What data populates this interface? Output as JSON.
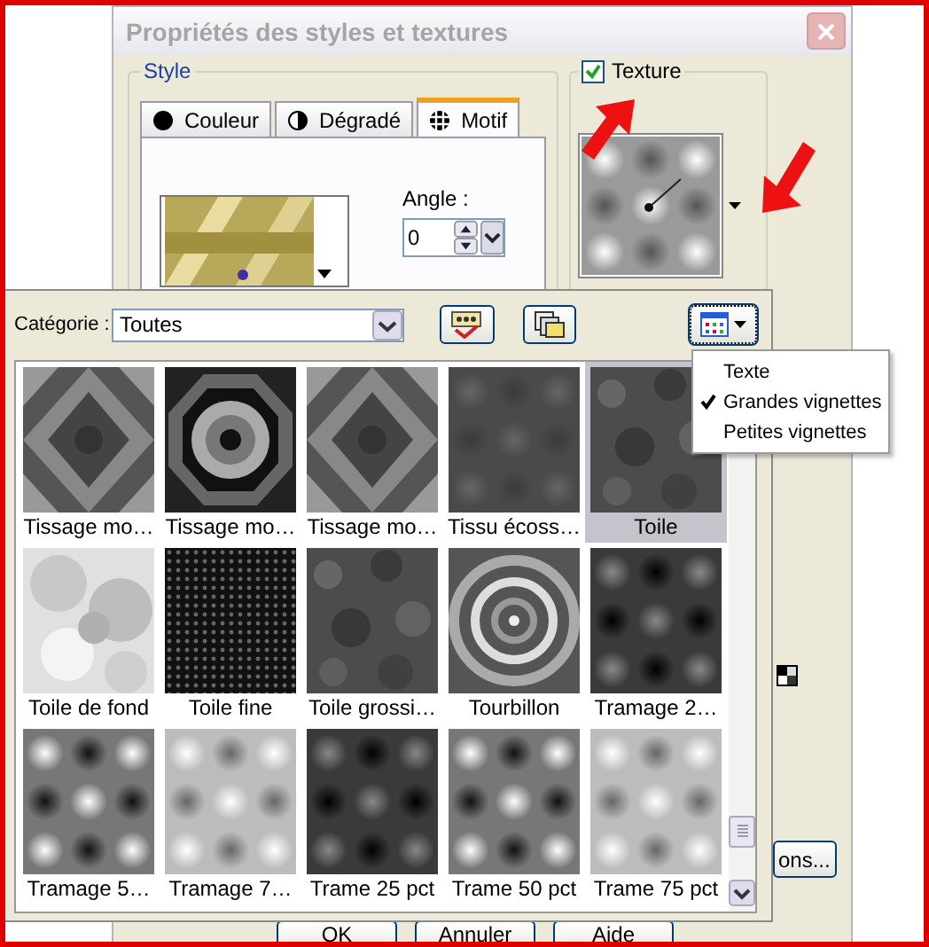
{
  "window": {
    "title": "Propriétés des styles et textures"
  },
  "style_group": {
    "title": "Style",
    "tabs": [
      {
        "label": "Couleur",
        "selected": false
      },
      {
        "label": "Dégradé",
        "selected": false
      },
      {
        "label": "Motif",
        "selected": true
      }
    ],
    "angle": {
      "label": "Angle :",
      "value": "0"
    }
  },
  "texture": {
    "label": "Texture",
    "checked": true
  },
  "options_button": "ons...",
  "buttons": [
    "OK",
    "Annuler",
    "Aide"
  ],
  "pattern_picker": {
    "category_label": "Catégorie :",
    "category_value": "Toutes",
    "thumbnails": [
      {
        "label": "Tissage mo…",
        "selected": false
      },
      {
        "label": "Tissage mo…",
        "selected": false
      },
      {
        "label": "Tissage mo…",
        "selected": false
      },
      {
        "label": "Tissu écoss…",
        "selected": false
      },
      {
        "label": "Toile",
        "selected": true
      },
      {
        "label": "Toile de fond",
        "selected": false
      },
      {
        "label": "Toile fine",
        "selected": false
      },
      {
        "label": "Toile grossi…",
        "selected": false
      },
      {
        "label": "Tourbillon",
        "selected": false
      },
      {
        "label": "Tramage 2…",
        "selected": false
      },
      {
        "label": "Tramage 5…",
        "selected": false
      },
      {
        "label": "Tramage 7…",
        "selected": false
      },
      {
        "label": "Trame 25 pct",
        "selected": false
      },
      {
        "label": "Trame 50 pct",
        "selected": false
      },
      {
        "label": "Trame 75 pct",
        "selected": false
      }
    ]
  },
  "view_menu": {
    "items": [
      {
        "label": "Texte",
        "checked": false
      },
      {
        "label": "Grandes vignettes",
        "checked": true
      },
      {
        "label": "Petites vignettes",
        "checked": false
      }
    ]
  }
}
